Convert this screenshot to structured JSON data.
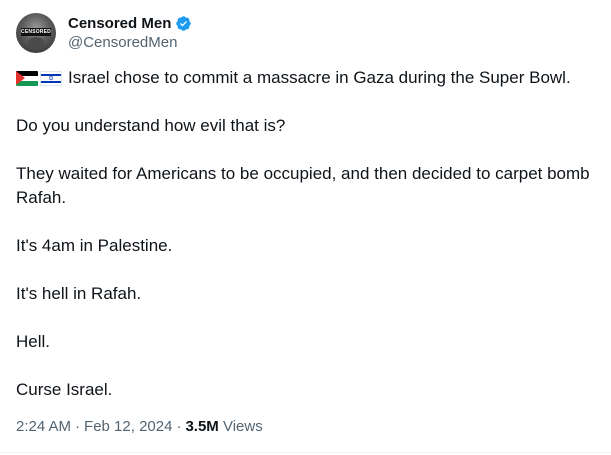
{
  "author": {
    "display_name": "Censored Men",
    "handle": "@CensoredMen",
    "avatar_text": "CENSORED",
    "verified": true,
    "verified_color": "#1d9bf0"
  },
  "tweet": {
    "flags": [
      "palestine-flag-icon",
      "israel-flag-icon"
    ],
    "first_line": "Israel chose to commit a massacre in Gaza during the Super Bowl.",
    "paragraphs": [
      "Do you understand how evil that is?",
      "They waited for Americans to be occupied, and then decided to carpet bomb Rafah.",
      "It's 4am in Palestine.",
      "It's hell in Rafah.",
      "Hell.",
      "Curse Israel."
    ]
  },
  "meta": {
    "time": "2:24 AM",
    "separator": "·",
    "date": "Feb 12, 2024",
    "views_count": "3.5M",
    "views_label": "Views"
  },
  "colors": {
    "text": "#0f1419",
    "secondary": "#536471",
    "accent": "#1d9bf0"
  }
}
